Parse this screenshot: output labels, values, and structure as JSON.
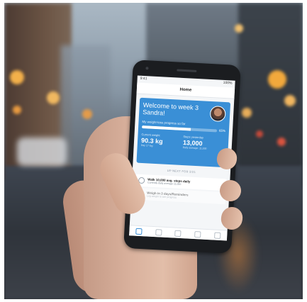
{
  "app": {
    "status_time": "9:41",
    "status_right": "100%",
    "nav_title": "Home",
    "welcome": "Welcome to week 3 Sandra!",
    "progress_label": "My weight-loss progress so far",
    "progress_fraction": 0.65,
    "progress_pct": "65%",
    "stat1_label": "Current weight",
    "stat1_value": "90.3 kg",
    "stat1_sub": "Day 17 log",
    "stat2_label": "Steps yesterday",
    "stat2_value": "13,000",
    "stat2_sub": "Daily average: 11,000",
    "section_label": "UP NEXT FOR 3/21",
    "task1_title": "Walk 10,000 avg. steps daily",
    "task1_sub": "Currently daily average 11,000",
    "task2_title": "Weigh in 3 days/Reminders",
    "task2_sub": "Log weight to see progress",
    "tabs": [
      "home-tab-icon",
      "activity-tab-icon",
      "log-tab-icon",
      "messages-tab-icon",
      "profile-tab-icon"
    ]
  },
  "colors": {
    "accent": "#3a8fd6",
    "bokeh": "#f3b04a"
  }
}
